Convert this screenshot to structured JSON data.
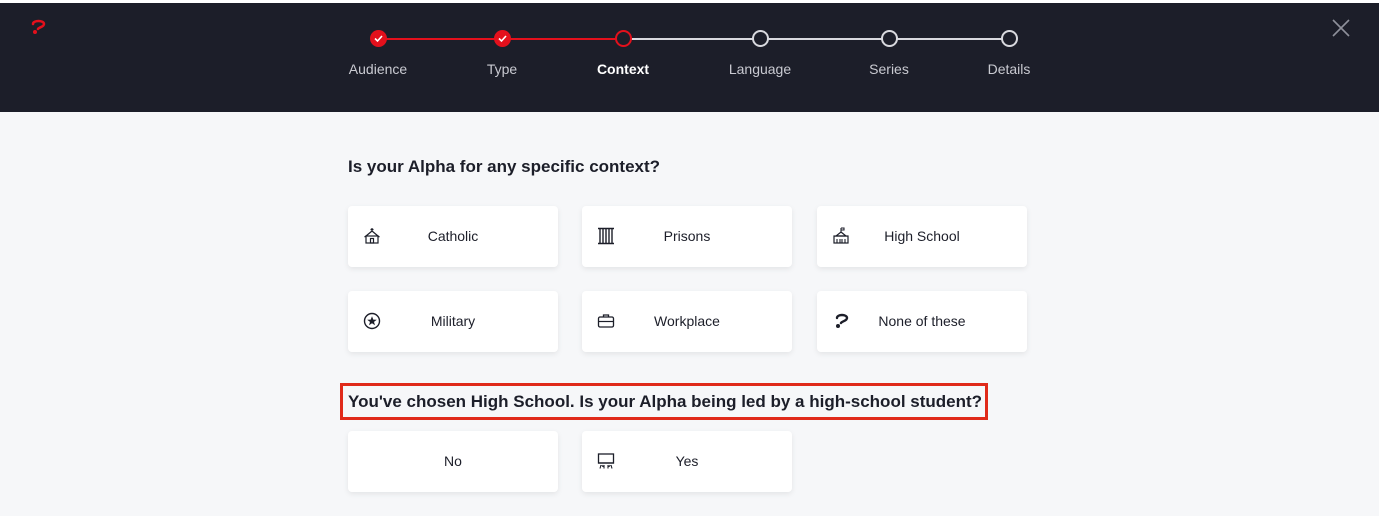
{
  "header": {
    "logo_icon": "alpha-logo-icon",
    "close_icon": "close-icon",
    "accent_color": "#e3101c",
    "background_color": "#1c1e29"
  },
  "steps": [
    {
      "label": "Audience",
      "state": "done"
    },
    {
      "label": "Type",
      "state": "done"
    },
    {
      "label": "Context",
      "state": "current"
    },
    {
      "label": "Language",
      "state": "todo"
    },
    {
      "label": "Series",
      "state": "todo"
    },
    {
      "label": "Details",
      "state": "todo"
    }
  ],
  "context_question": "Is your Alpha for any specific context?",
  "context_options": [
    {
      "label": "Catholic",
      "icon": "church-icon"
    },
    {
      "label": "Prisons",
      "icon": "prison-bars-icon"
    },
    {
      "label": "High School",
      "icon": "school-building-icon"
    },
    {
      "label": "Military",
      "icon": "star-badge-icon"
    },
    {
      "label": "Workplace",
      "icon": "briefcase-icon"
    },
    {
      "label": "None of these",
      "icon": "alpha-logo-icon"
    }
  ],
  "followup_question": "You've chosen High School. Is your Alpha being led by a high-school student?",
  "followup_options": [
    {
      "label": "No",
      "icon": ""
    },
    {
      "label": "Yes",
      "icon": "whiteboard-icon"
    }
  ]
}
